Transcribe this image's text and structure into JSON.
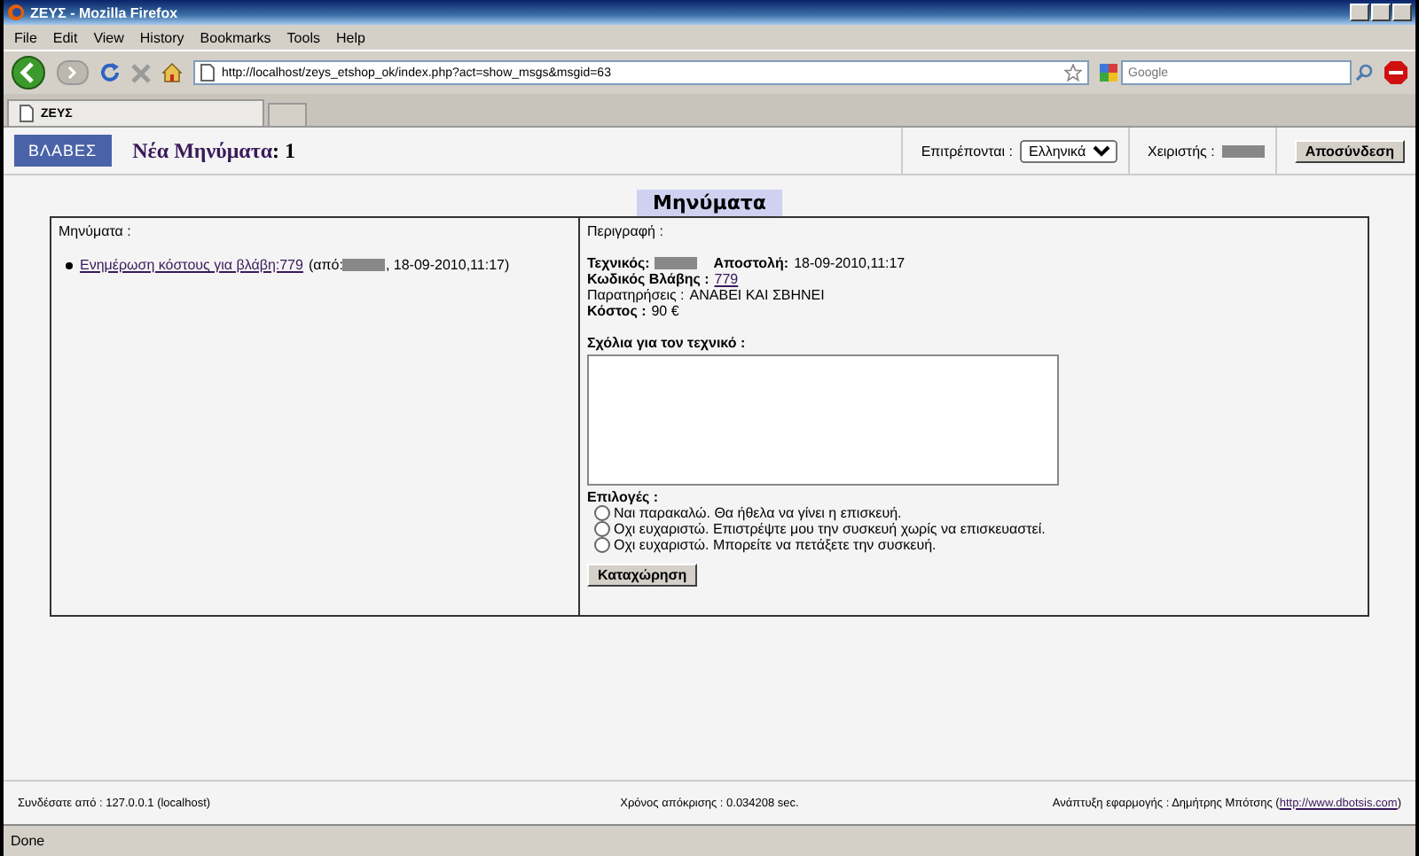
{
  "window": {
    "title": "ΖΕΥΣ - Mozilla Firefox"
  },
  "menu": [
    "File",
    "Edit",
    "View",
    "History",
    "Bookmarks",
    "Tools",
    "Help"
  ],
  "address": {
    "value": "http://localhost/zeys_etshop_ok/index.php?act=show_msgs&msgid=63"
  },
  "search": {
    "placeholder": "Google"
  },
  "tabs": [
    {
      "label": "ΖΕΥΣ",
      "selected": true
    }
  ],
  "header": {
    "logo": "ΒΛΑΒΕΣ",
    "new_messages_link": "Νέα Μηνύματα",
    "new_messages_count": ": 1",
    "language_label": "Επιτρέπονται :",
    "language": "Ελληνικά",
    "user_label": "Χειριστής :",
    "logout": "Αποσύνδεση"
  },
  "page_title": "Μηνύματα",
  "messages": {
    "heading": "Μηνύματα :",
    "items": [
      {
        "link": "Ενημέρωση κόστους για βλάβη:779",
        "from": "(από:",
        "date": ", 18-09-2010,11:17)"
      }
    ]
  },
  "details": {
    "heading": "Περιγραφή :",
    "technician_label": "Τεχνικός:",
    "sent_label": "Αποστολή:",
    "sent": "18-09-2010,11:17",
    "fault_code_label": "Κωδικός Βλάβης :",
    "fault_code": "779",
    "notes_label": "Παρατηρήσεις :",
    "notes": "ΑΝΑΒΕΙ ΚΑΙ ΣΒΗΝΕΙ",
    "cost_label": "Κόστος :",
    "cost": "90 €",
    "comments_label": "Σχόλια για τον τεχνικό :",
    "options_label": "Επιλογές :",
    "options": [
      {
        "label": "Ναι παρακαλώ. Θα ήθελα να γίνει η επισκευή.",
        "selected": false
      },
      {
        "label": "Οχι ευχαριστώ. Επιστρέψτε μου την συσκευή χωρίς να επισκευαστεί.",
        "selected": false
      },
      {
        "label": "Οχι ευχαριστώ. Μπορείτε να πετάξετε την συσκευή.",
        "selected": false
      }
    ],
    "submit": "Καταχώρηση"
  },
  "footer": {
    "connected": "Συνδέσατε από : 127.0.0.1 (localhost)",
    "response_time": "Χρόνος απόκρισης : 0.034208 sec.",
    "credit": "Ανάπτυξη εφαρμογής : Δημήτρης Μπότσης (",
    "credit_link": "http://www.dbotsis.com",
    "credit_end": ")"
  },
  "status_bar": {
    "text": "Done"
  }
}
